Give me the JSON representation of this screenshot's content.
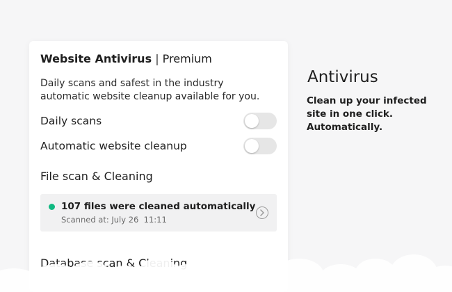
{
  "card": {
    "title_bold": "Website Antivirus",
    "title_separator": "|",
    "title_tier": "Premium",
    "description": "Daily scans and safest in the industry automatic website cleanup available for you.",
    "settings": [
      {
        "label": "Daily scans",
        "enabled": false
      },
      {
        "label": "Automatic website cleanup",
        "enabled": false
      }
    ],
    "file_section": {
      "title": "File scan & Cleaning",
      "status_color": "#10b981",
      "result": "107 files were cleaned automatically",
      "scanned_at": "Scanned at: July 26  11:11",
      "detail_icon": "chevron-right-icon"
    },
    "database_section": {
      "title": "Database scan & Cleaning"
    }
  },
  "promo": {
    "heading": "Antivirus",
    "text": "Clean up your infected site in one click. Automatically."
  }
}
